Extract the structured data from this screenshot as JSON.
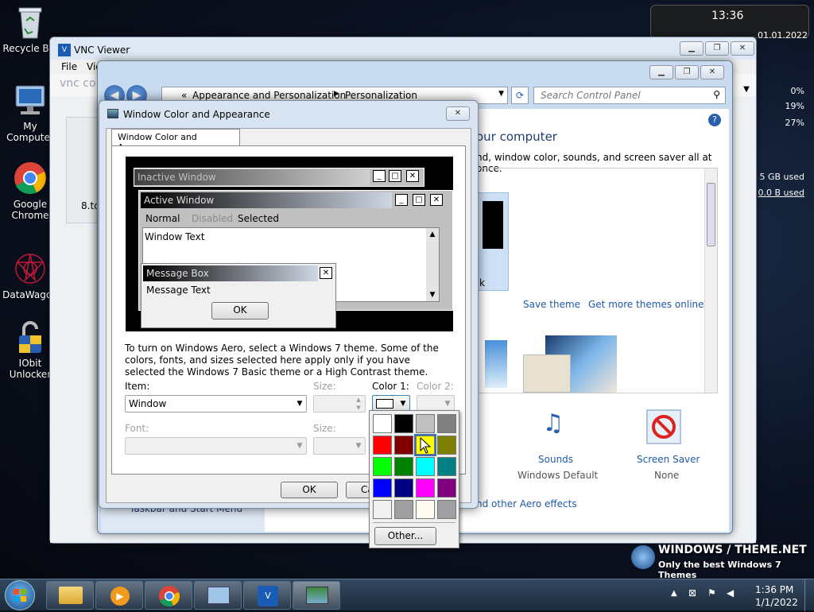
{
  "desktop": {
    "icons": [
      {
        "label": "Recycle Bin",
        "name": "recycle-bin"
      },
      {
        "label": "My Computer",
        "name": "my-computer"
      },
      {
        "label": "Google Chrome",
        "name": "google-chrome"
      },
      {
        "label": "DataWagon",
        "name": "datawagon"
      },
      {
        "label": "IObit Unlocker",
        "name": "iobit-unlocker"
      }
    ],
    "partial_label": "8.tc"
  },
  "gadget": {
    "time": "13:36",
    "date": "01.01.2022",
    "cpu": [
      "0%",
      "19%",
      "27%"
    ],
    "disk": [
      "5 GB used",
      "0.0 B used"
    ]
  },
  "vnc": {
    "title": "VNC Viewer",
    "menu": [
      "File",
      "Vie"
    ],
    "logo": "vnc co"
  },
  "control_panel": {
    "breadcrumb": [
      "Appearance and Personalization",
      "Personalization"
    ],
    "breadcrumb_prefix": "«",
    "search_placeholder": "Search Control Panel",
    "heading_partial": "our computer",
    "subtitle_partial": "nd, window color, sounds, and screen saver all at once.",
    "theme_label_partial": "k",
    "save_theme": "Save theme",
    "get_more": "Get more themes online",
    "sounds_label": "Sounds",
    "sounds_value": "Windows Default",
    "screensaver_label": "Screen Saver",
    "screensaver_value": "None",
    "aero_link_partial": "nd other Aero effects",
    "taskbar_partial": "Taskbar and Start Menu"
  },
  "dialog": {
    "title": "Window Color and Appearance",
    "tab": "Window Color and Appearance",
    "preview": {
      "inactive_title": "Inactive Window",
      "active_title": "Active Window",
      "menu": [
        "Normal",
        "Disabled",
        "Selected"
      ],
      "window_text": "Window Text",
      "msgbox_title": "Message Box",
      "msgbox_text": "Message Text",
      "ok": "OK"
    },
    "info": "To turn on Windows Aero, select a Windows 7 theme.  Some of the colors, fonts, and sizes selected here apply only if you have selected the Windows 7 Basic theme or a High Contrast theme.",
    "item_label": "Item:",
    "item_value": "Window",
    "size_label": "Size:",
    "color1_label": "Color 1:",
    "color2_label": "Color 2:",
    "font_label": "Font:",
    "size2_label": "Size:",
    "ok_btn": "OK",
    "cancel_partial": "Ca"
  },
  "palette": {
    "colors": [
      "#ffffff",
      "#000000",
      "#c0c0c0",
      "#808080",
      "#ff0000",
      "#800000",
      "#ffff00",
      "#808000",
      "#00ff00",
      "#008000",
      "#00ffff",
      "#008080",
      "#0000ff",
      "#000080",
      "#ff00ff",
      "#800080",
      "#f0f0f0",
      "#a0a0a0",
      "#fffbf0",
      "#a0a0a4"
    ],
    "other": "Other..."
  },
  "watermark": {
    "line1": "WINDOWS / THEME.NET",
    "line2": "Only the best Windows 7 Themes"
  },
  "taskbar": {
    "time": "1:36 PM",
    "date": "1/1/2022"
  }
}
